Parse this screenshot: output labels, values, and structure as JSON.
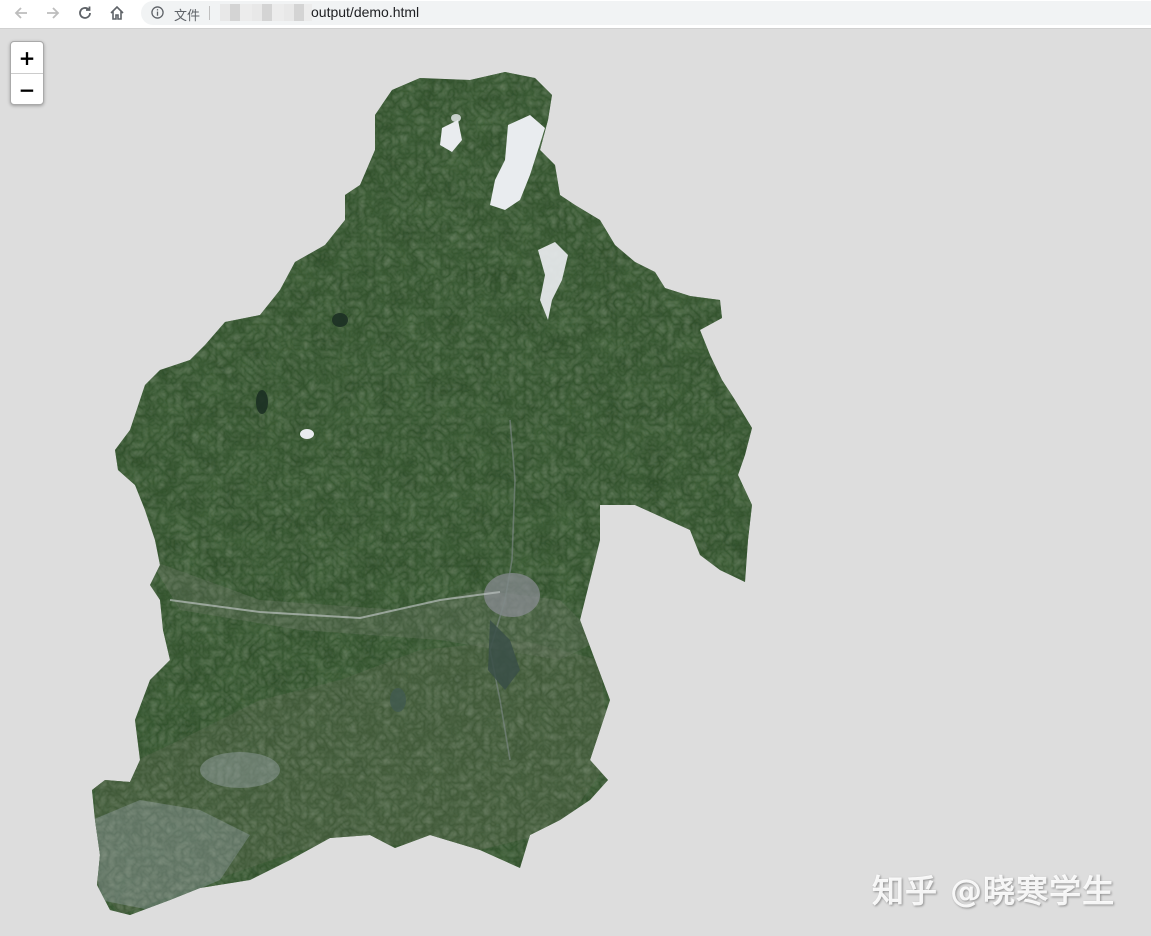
{
  "browser": {
    "back_icon": "arrow-left-icon",
    "forward_icon": "arrow-right-icon",
    "reload_icon": "reload-icon",
    "home_icon": "home-icon",
    "info_icon": "info-circle-icon",
    "file_label": "文件",
    "url_visible": "output/demo.html"
  },
  "map": {
    "zoom_in_label": "+",
    "zoom_out_label": "−",
    "background_color": "#dddddd",
    "layer": "satellite imagery of county region",
    "land_color": "#2c4a27",
    "cloud_color": "#e9ecef"
  },
  "watermark": {
    "text": "知乎 @晓寒学生"
  }
}
